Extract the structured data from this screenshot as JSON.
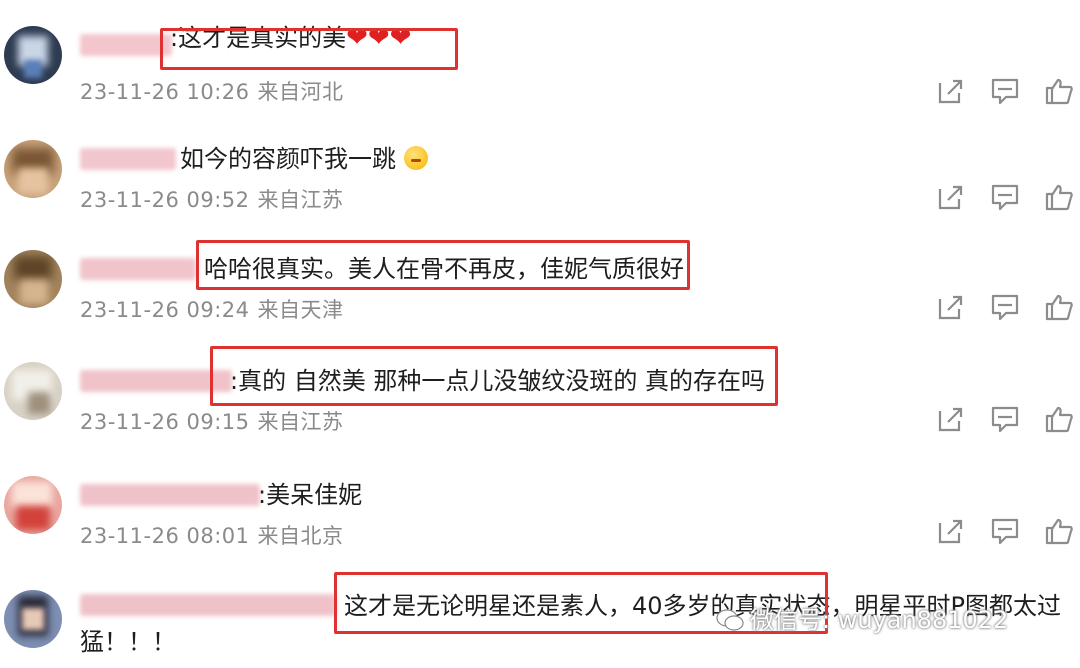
{
  "comments": [
    {
      "text": ":这才是真实的美",
      "hearts": "❤❤❤",
      "time": "23-11-26 10:26",
      "location": "来自河北"
    },
    {
      "text": "如今的容颜吓我一跳",
      "time": "23-11-26 09:52",
      "location": "来自江苏"
    },
    {
      "text": "哈哈很真实。美人在骨不再皮，佳妮气质很好",
      "time": "23-11-26 09:24",
      "location": "来自天津"
    },
    {
      "text": ":真的 自然美 那种一点儿没皱纹没斑的 真的存在吗",
      "time": "23-11-26 09:15",
      "location": "来自江苏"
    },
    {
      "text": ":美呆佳妮",
      "time": "23-11-26 08:01",
      "location": "来自北京"
    },
    {
      "text": "这才是无论明星还是素人，40多岁的真实状态，明星平时P图都太过",
      "text_line2": "猛！！！"
    }
  ],
  "icons": {
    "share": "share-icon",
    "comment": "comment-icon",
    "like": "thumbs-up-icon"
  },
  "watermark": {
    "label": "微信号: wuyan881022"
  },
  "colors": {
    "highlight": "#e03131",
    "meta": "#8a8a8a",
    "icon": "#8c8c8c"
  }
}
